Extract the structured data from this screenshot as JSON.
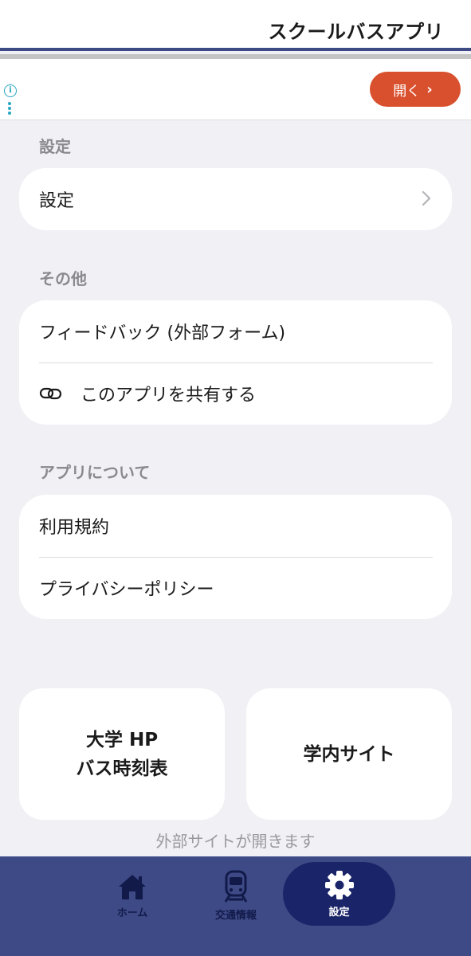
{
  "header": {
    "title": "スクールバスアプリ"
  },
  "ad": {
    "info_icon": "info-icon",
    "open_label": "開く",
    "open_chevron": "›"
  },
  "sections": {
    "settings": {
      "label": "設定",
      "items": [
        {
          "label": "設定"
        }
      ]
    },
    "other": {
      "label": "その他",
      "items": [
        {
          "label": "フィードバック (外部フォーム)"
        },
        {
          "label": "このアプリを共有する",
          "icon": "link-icon"
        }
      ]
    },
    "about": {
      "label": "アプリについて",
      "items": [
        {
          "label": "利用規約"
        },
        {
          "label": "プライバシーポリシー"
        }
      ]
    }
  },
  "links": {
    "university_line1": "大学 HP",
    "university_line2": "バス時刻表",
    "campus_site": "学内サイト",
    "external_note": "外部サイトが開きます"
  },
  "tabbar": {
    "tabs": [
      {
        "label": "ホーム",
        "icon": "home-icon"
      },
      {
        "label": "交通情報",
        "icon": "train-icon"
      },
      {
        "label": "設定",
        "icon": "gear-icon",
        "active": true
      }
    ]
  },
  "colors": {
    "navy": "#3e4a86",
    "active_tab": "#1a2468",
    "ad_button": "#d9502e",
    "background": "#f0f0f5"
  }
}
